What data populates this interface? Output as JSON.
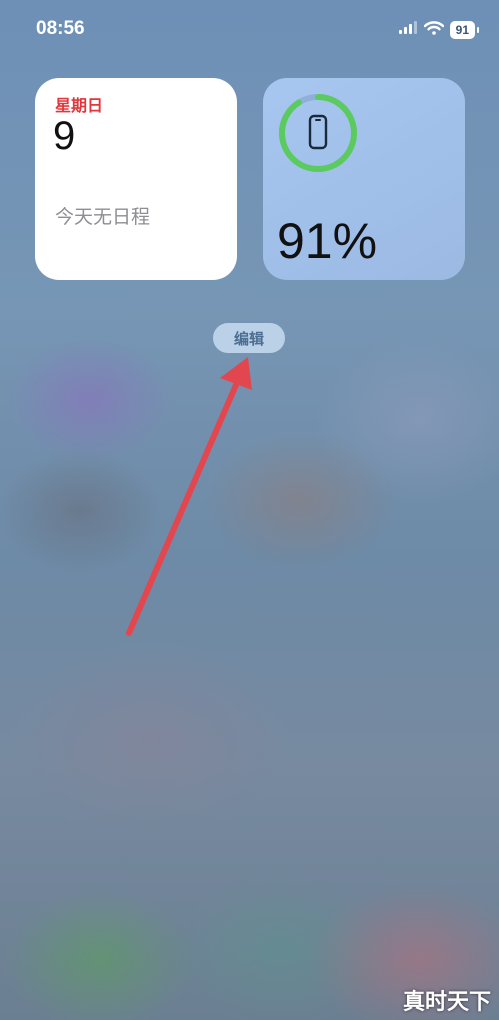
{
  "status_bar": {
    "time": "08:56",
    "battery_level": "91",
    "icons": [
      "cellular-signal-icon",
      "wifi-icon",
      "battery-icon"
    ]
  },
  "calendar_widget": {
    "weekday": "星期日",
    "day": "9",
    "events_text": "今天无日程",
    "accent_color": "#e0383e"
  },
  "battery_widget": {
    "percent_text": "91%",
    "charge_fraction": 0.91,
    "ring_color": "#5ccb5f",
    "icon": "iphone-icon"
  },
  "edit_button": {
    "label": "编辑"
  },
  "annotation": {
    "arrow_color": "#e2474f",
    "points_to": "edit_button"
  },
  "watermark": "真时天下"
}
